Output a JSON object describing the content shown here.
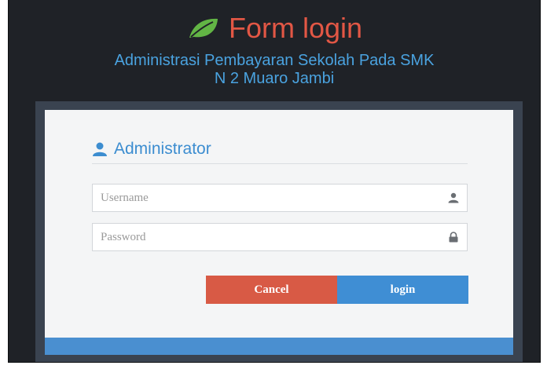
{
  "header": {
    "icon": "leaf-icon",
    "title": "Form login",
    "subtitle_line1": "Administrasi Pembayaran Sekolah Pada SMK",
    "subtitle_line2": "N 2 Muaro Jambi"
  },
  "panel": {
    "icon": "user-icon",
    "title": "Administrator",
    "username": {
      "value": "",
      "placeholder": "Username",
      "icon": "user-icon"
    },
    "password": {
      "value": "",
      "placeholder": "Password",
      "icon": "lock-icon"
    },
    "cancel_label": "Cancel",
    "login_label": "login"
  },
  "colors": {
    "background": "#1f2227",
    "title": "#e25745",
    "leaf": "#62b545",
    "subtitle": "#4aa3e0",
    "panel_frame": "#3a4350",
    "panel_bg": "#f4f5f6",
    "panel_footer": "#4a8fd0",
    "cancel_button": "#d85a45",
    "login_button": "#3f8ed4"
  }
}
